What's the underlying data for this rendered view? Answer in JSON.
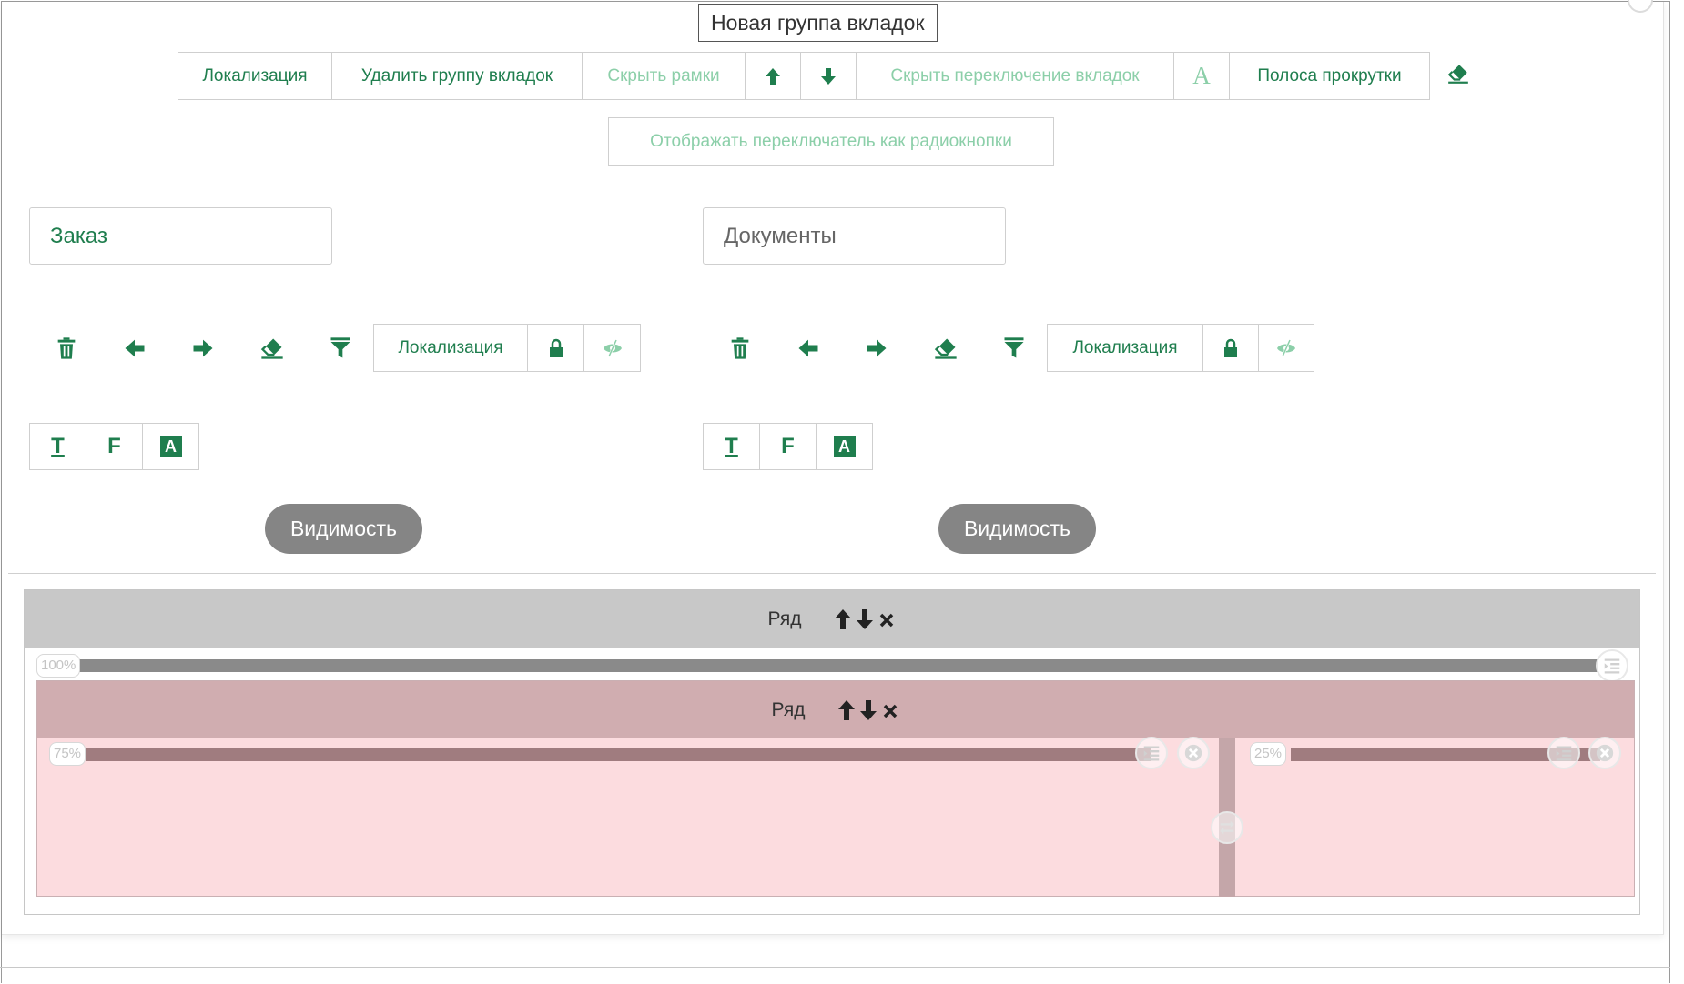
{
  "group_title": "Новая группа вкладок",
  "toolbar": {
    "localization": "Локализация",
    "delete_group": "Удалить группу вкладок",
    "hide_frames": "Скрыть рамки",
    "hide_tab_switch": "Скрыть переключение вкладок",
    "font_glyph": "A",
    "scrollbar": "Полоса прокрутки",
    "radio_switch": "Отображать переключатель как радиокнопки"
  },
  "tabs": [
    {
      "name": "Заказ",
      "state": "active",
      "localization": "Локализация",
      "format_t": "T",
      "format_f": "F",
      "format_a": "A",
      "visibility": "Видимость"
    },
    {
      "name": "Документы",
      "state": "inactive",
      "localization": "Локализация",
      "format_t": "T",
      "format_f": "F",
      "format_a": "A",
      "visibility": "Видимость"
    }
  ],
  "layout": {
    "outer_row": {
      "label": "Ряд",
      "column_width": "100%"
    },
    "inner_row": {
      "label": "Ряд",
      "columns": [
        {
          "width": "75%"
        },
        {
          "width": "25%"
        }
      ]
    }
  },
  "colors": {
    "accent_green": "#1f7e4e",
    "faint_green": "#8ccfa9",
    "visibility_button": "#858585",
    "outer_row_header": "#c8c8c8",
    "inner_row_header": "#d0adb0",
    "inner_row_body": "#fcdcdf"
  },
  "icons": [
    "trash-icon",
    "arrow-left-icon",
    "arrow-right-icon",
    "eraser-icon",
    "filter-icon",
    "lock-icon",
    "eye-slash-icon",
    "arrow-up-icon",
    "arrow-down-icon",
    "close-icon",
    "indent-icon",
    "swap-icon"
  ]
}
